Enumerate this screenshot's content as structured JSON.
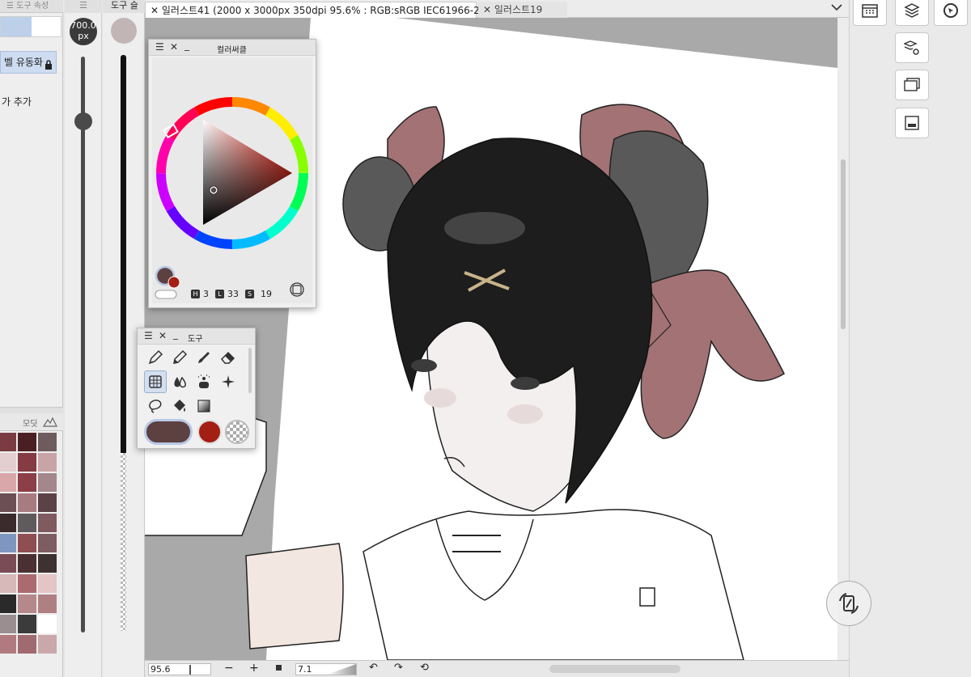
{
  "left_panel": {
    "tab_label": "도구 속성",
    "stabilization_label": "벨 유동화",
    "add_label": "가 추가",
    "palette_tab_label": "모딧",
    "palette_colors": [
      "#7a3c42",
      "#4a1f24",
      "#6d5b5d",
      "#e3cfd0",
      "#843b41",
      "#c9a4a6",
      "#d9a7aa",
      "#8c3f46",
      "#a4878a",
      "#6b4f54",
      "#a87b80",
      "#5a4246",
      "#3b2b2d",
      "#5f5a5b",
      "#7f5a5e",
      "#7f96bf",
      "#8f4e52",
      "#7d5d61",
      "#7a4c56",
      "#4a3032",
      "#3d3132",
      "#d7b9b9",
      "#ab6b6e",
      "#e3c5c5",
      "#2a2a2a",
      "#b5888b",
      "#af8082",
      "#9a8e90",
      "#3b3b3b",
      "#ffffff",
      "#b07a80",
      "#9f6a70",
      "#c9a7aa"
    ]
  },
  "brush_size": {
    "value": "700.0",
    "unit": "px",
    "level": 0.9
  },
  "opacity_panel": {
    "tab_label": "도구 슬"
  },
  "document_tabs": [
    {
      "label": "일러스트41 (2000 x 3000px 350dpi 95.6% : RGB:sRGB IEC61966-2.1)",
      "close": "✕"
    },
    {
      "label": "일러스트19",
      "close": "✕"
    }
  ],
  "status_bar": {
    "zoom": "95.6",
    "zoom_out": "−",
    "zoom_in": "+",
    "angle": "7.1",
    "rotate_left": "↶",
    "rotate_right": "↷",
    "reset_rotate": "⟲"
  },
  "color_circle": {
    "title": "컬러써클",
    "hue_tag": "H",
    "hue": "3",
    "lightness_tag": "L",
    "lightness": "33",
    "saturation_tag": "S",
    "saturation": "19",
    "main_color": "#5d4040",
    "sub_color": "#a31e13"
  },
  "tool_window": {
    "title": "도구",
    "tools": [
      "pen-icon",
      "pencil-icon",
      "brush-icon",
      "eraser-icon",
      "select-icon",
      "blend-icon",
      "airbrush-icon",
      "sparkle-icon",
      "lasso-icon",
      "fill-icon",
      "gradient-icon"
    ]
  },
  "window_controls": {
    "menu": "☰",
    "close": "✕",
    "minimize": "_"
  },
  "right_toolbar": {
    "buttons": [
      "calendar-grid-icon",
      "layers-icon",
      "navigator-icon",
      "layer-properties-icon",
      "image-tile-icon",
      "full-layers-icon"
    ]
  },
  "colors": {
    "hair_bow": "#a37274",
    "ear_gray": "#595959",
    "hair_black": "#1d1d1d"
  }
}
